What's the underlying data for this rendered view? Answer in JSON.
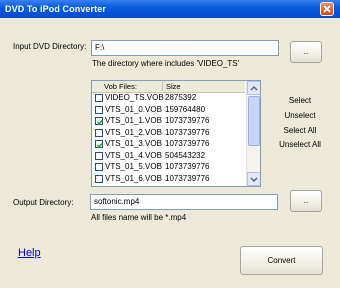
{
  "window": {
    "title": "DVD To iPod Converter"
  },
  "input_dvd": {
    "label": "Input DVD Directory:",
    "value": "F:\\",
    "hint": "The directory where includes 'VIDEO_TS'",
    "browse_label": ".."
  },
  "file_list": {
    "columns": [
      "Vob Files:",
      "Size"
    ],
    "rows": [
      {
        "name": "VIDEO_TS.VOB",
        "size": "2875392",
        "checked": false
      },
      {
        "name": "VTS_01_0.VOB",
        "size": "159764480",
        "checked": false
      },
      {
        "name": "VTS_01_1.VOB",
        "size": "1073739776",
        "checked": true
      },
      {
        "name": "VTS_01_2.VOB",
        "size": "1073739776",
        "checked": false
      },
      {
        "name": "VTS_01_3.VOB",
        "size": "1073739776",
        "checked": true
      },
      {
        "name": "VTS_01_4.VOB",
        "size": "504543232",
        "checked": false
      },
      {
        "name": "VTS_01_5.VOB",
        "size": "1073739776",
        "checked": false
      },
      {
        "name": "VTS_01_6.VOB",
        "size": "1073739776",
        "checked": false
      }
    ]
  },
  "actions": {
    "select": "Select",
    "unselect": "Unselect",
    "select_all": "Select All",
    "unselect_all": "Unselect All"
  },
  "output": {
    "label": "Output Directory:",
    "value": "softonic.mp4",
    "hint": "All files name will be *.mp4",
    "browse_label": ".."
  },
  "help_label": "Help",
  "convert_label": "Convert"
}
